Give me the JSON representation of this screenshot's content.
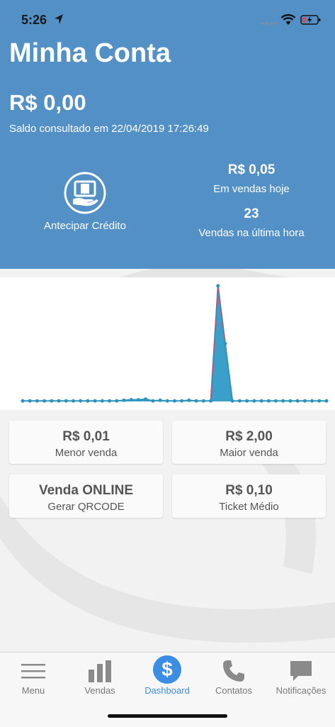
{
  "status_bar": {
    "time": "5:26"
  },
  "header": {
    "title": "Minha Conta",
    "balance": "R$ 0,00",
    "balance_caption": "Saldo consultado em 22/04/2019 17:26:49",
    "advance_credit_label": "Antecipar Crédito",
    "sales_today_value": "R$ 0,05",
    "sales_today_label": "Em vendas hoje",
    "sales_last_hour_value": "23",
    "sales_last_hour_label": "Vendas na última hora"
  },
  "colors": {
    "header_bg": "#5290c6",
    "chart_line": "#2f93c0",
    "chart_fill": "#3aa0c9",
    "chart_peak_stroke": "#e0455a",
    "active_tab": "#3b8ee3"
  },
  "chart_data": {
    "type": "area",
    "values": [
      0.01,
      0.01,
      0.01,
      0.01,
      0.01,
      0.01,
      0.01,
      0.01,
      0.01,
      0.01,
      0.01,
      0.01,
      0.01,
      0.01,
      0.02,
      0.03,
      0.03,
      0.04,
      0.01,
      0.02,
      0.01,
      0.01,
      0.01,
      0.02,
      0.01,
      0.01,
      0.01,
      2.0,
      1.0,
      0.01,
      0.01,
      0.01,
      0.01,
      0.01,
      0.01,
      0.01,
      0.01,
      0.01,
      0.01,
      0.01,
      0.01,
      0.01,
      0.01
    ],
    "ylim": [
      0,
      2.0
    ],
    "grid": false,
    "legend": "none"
  },
  "cards": [
    {
      "value": "R$ 0,01",
      "label": "Menor venda"
    },
    {
      "value": "R$ 2,00",
      "label": "Maior venda"
    },
    {
      "value": "Venda ONLINE",
      "label": "Gerar QRCODE"
    },
    {
      "value": "R$ 0,10",
      "label": "Ticket Médio"
    }
  ],
  "tabs": [
    {
      "label": "Menu",
      "icon": "hamburger-icon"
    },
    {
      "label": "Vendas",
      "icon": "bar-chart-icon"
    },
    {
      "label": "Dashboard",
      "icon": "dollar-icon",
      "active": true
    },
    {
      "label": "Contatos",
      "icon": "phone-icon"
    },
    {
      "label": "Notificações",
      "icon": "chat-bubble-icon"
    }
  ]
}
